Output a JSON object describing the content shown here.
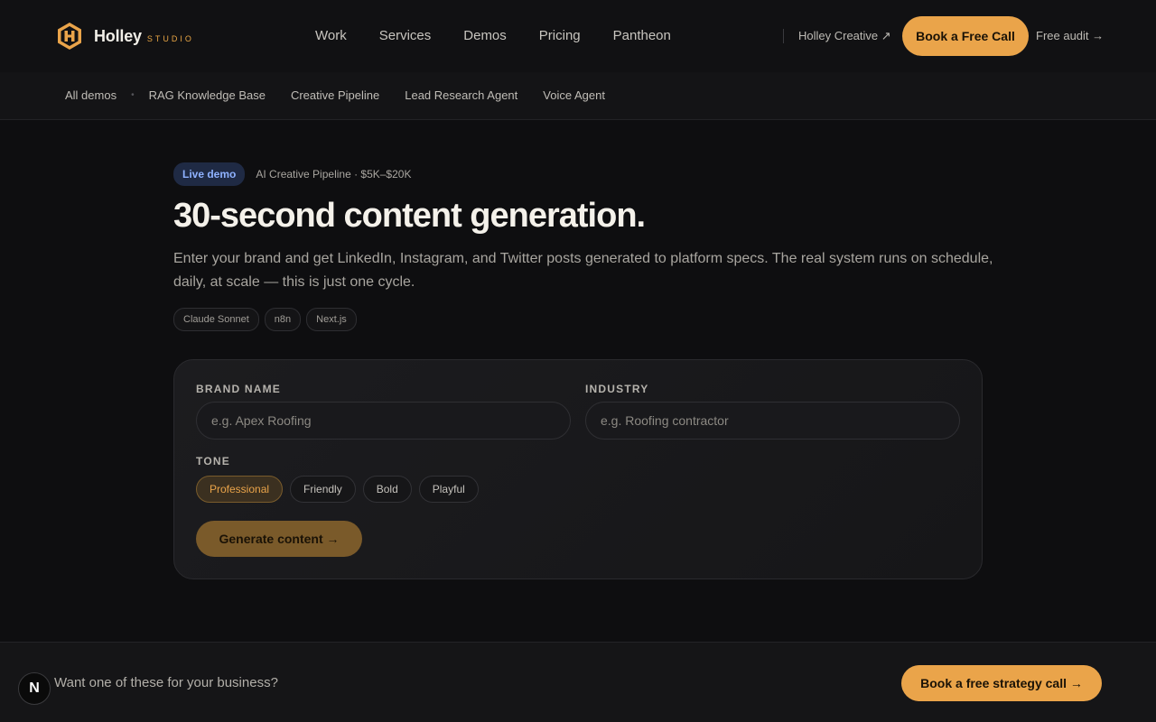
{
  "header": {
    "logo_name": "Holley",
    "logo_sub": "STUDIO",
    "nav": [
      "Work",
      "Services",
      "Demos",
      "Pricing",
      "Pantheon"
    ],
    "creative_link": "Holley Creative ↗",
    "book_call": "Book a Free Call",
    "audit_link": "Free audit →"
  },
  "subnav": {
    "all_demos": "All demos",
    "items": [
      "RAG Knowledge Base",
      "Creative Pipeline",
      "Lead Research Agent",
      "Voice Agent"
    ]
  },
  "main": {
    "badge": "Live demo",
    "badge_meta": "AI Creative Pipeline · $5K–$20K",
    "title": "30-second content generation.",
    "description": "Enter your brand and get LinkedIn, Instagram, and Twitter posts generated to platform specs. The real system runs on schedule, daily, at scale — this is just one cycle.",
    "tags": [
      "Claude Sonnet",
      "n8n",
      "Next.js"
    ]
  },
  "form": {
    "brand_label": "BRAND NAME",
    "brand_placeholder": "e.g. Apex Roofing",
    "industry_label": "INDUSTRY",
    "industry_placeholder": "e.g. Roofing contractor",
    "tone_label": "TONE",
    "tones": [
      "Professional",
      "Friendly",
      "Bold",
      "Playful"
    ],
    "selected_tone": "Professional",
    "generate": "Generate content →"
  },
  "bottom": {
    "n_badge": "N",
    "cta_text": "Want one of these for your business?",
    "strategy_button": "Book a free strategy call →"
  },
  "colors": {
    "accent": "#eaa44a",
    "background": "#0e0e10",
    "badge": "#8fb2ff"
  }
}
